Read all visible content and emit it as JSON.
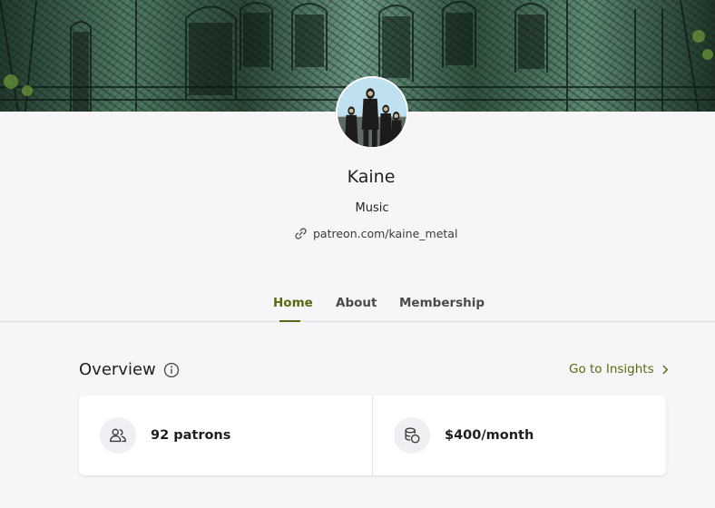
{
  "creator": {
    "name": "Kaine",
    "category": "Music",
    "link": "patreon.com/kaine_metal"
  },
  "tabs": [
    {
      "label": "Home",
      "active": true
    },
    {
      "label": "About",
      "active": false
    },
    {
      "label": "Membership",
      "active": false
    }
  ],
  "overview": {
    "title": "Overview",
    "insights_link": "Go to Insights",
    "stats": [
      {
        "icon": "patrons-icon",
        "value": "92 patrons"
      },
      {
        "icon": "coins-icon",
        "value": "$400/month"
      }
    ]
  },
  "colors": {
    "accent": "#586a0f",
    "background": "#f6f6f9",
    "card": "#ffffff"
  }
}
